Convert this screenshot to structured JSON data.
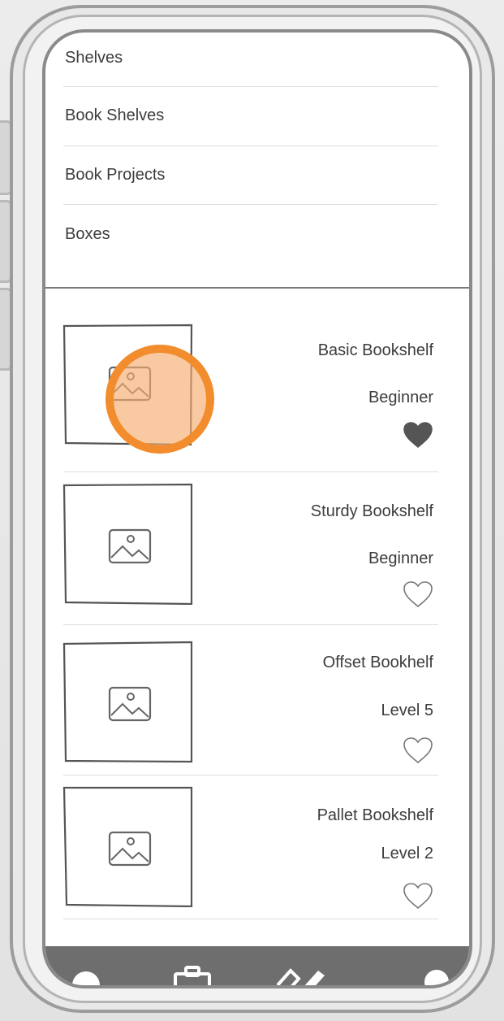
{
  "menu": {
    "items": [
      {
        "label": "Shelves"
      },
      {
        "label": "Book Shelves"
      },
      {
        "label": "Book Projects"
      },
      {
        "label": "Boxes"
      }
    ]
  },
  "projects": [
    {
      "title": "Basic Bookshelf",
      "level": "Beginner",
      "favorite": true,
      "image_icon": "image-placeholder-icon"
    },
    {
      "title": "Sturdy Bookshelf",
      "level": "Beginner",
      "favorite": false,
      "image_icon": "image-placeholder-icon"
    },
    {
      "title": "Offset Bookhelf",
      "level": "Level 5",
      "favorite": false,
      "image_icon": "image-placeholder-icon"
    },
    {
      "title": "Pallet Bookshelf",
      "level": "Level 2",
      "favorite": false,
      "image_icon": "image-placeholder-icon"
    }
  ],
  "tabbar": {
    "icons": [
      "home-icon",
      "clipboard-icon",
      "tools-icon",
      "profile-icon"
    ]
  },
  "colors": {
    "tap_highlight": "#f28c2c",
    "tabbar_bg": "#6e6e6e",
    "text": "#3c3c3c"
  }
}
